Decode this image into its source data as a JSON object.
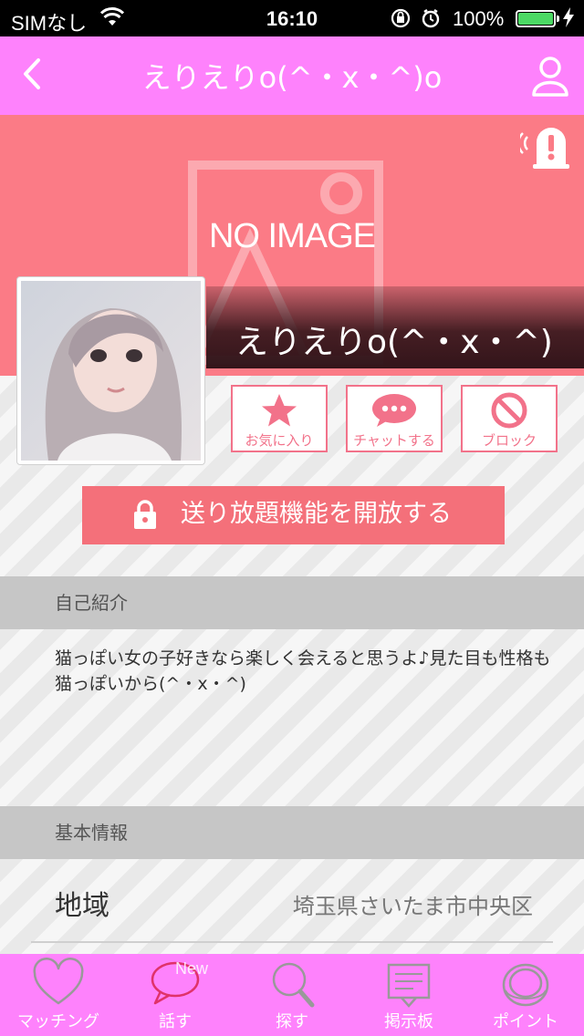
{
  "status_bar": {
    "carrier": "SIMなし",
    "time": "16:10",
    "battery_percent": "100%"
  },
  "nav": {
    "title": "えりえりo(^・x・^)o"
  },
  "profile": {
    "cover_placeholder": "NO IMAGE",
    "name": "えりえりo(^・x・^)"
  },
  "actions": {
    "favorite": "お気に入り",
    "chat": "チャットする",
    "block": "ブロック"
  },
  "unlock": {
    "label": "送り放題機能を開放する"
  },
  "intro": {
    "heading": "自己紹介",
    "text": "猫っぽい女の子好きなら楽しく会えると思うよ♪見た目も性格も猫っぽいから(^・x・^)"
  },
  "basic_info": {
    "heading": "基本情報",
    "rows": [
      {
        "key": "地域",
        "value": "埼玉県さいたま市中央区"
      }
    ]
  },
  "tabbar": {
    "items": [
      {
        "label": "マッチング",
        "icon": "heart-icon"
      },
      {
        "label": "話す",
        "icon": "speech-bubble-icon",
        "badge": "New"
      },
      {
        "label": "探す",
        "icon": "search-icon"
      },
      {
        "label": "掲示板",
        "icon": "board-icon"
      },
      {
        "label": "ポイント",
        "icon": "coin-icon"
      }
    ]
  },
  "colors": {
    "nav_pink": "#fe82fc",
    "cover_coral": "#fb7b86",
    "accent": "#f2728a",
    "battery_green": "#4cd964"
  }
}
